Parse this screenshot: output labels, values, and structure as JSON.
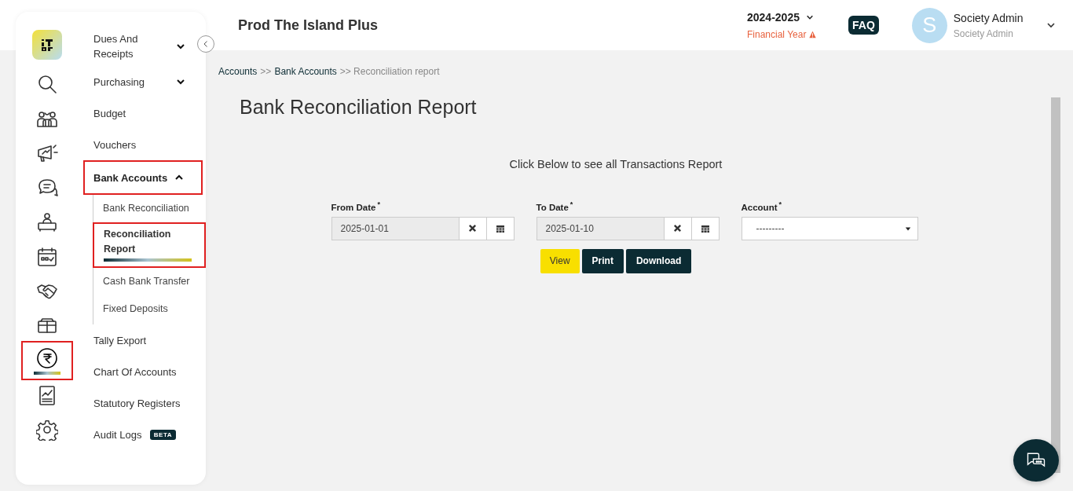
{
  "header": {
    "title": "Prod The Island Plus",
    "year": "2024-2025",
    "year_label": "Financial Year",
    "faq": "FAQ",
    "avatar_letter": "S",
    "user_name": "Society Admin",
    "user_role": "Society Admin"
  },
  "rail": [
    {
      "kind": "logo",
      "selected": false,
      "highlighted": false
    },
    {
      "kind": "search",
      "selected": false,
      "highlighted": false
    },
    {
      "kind": "people",
      "selected": false,
      "highlighted": false
    },
    {
      "kind": "megaphone",
      "selected": false,
      "highlighted": false
    },
    {
      "kind": "chat",
      "selected": false,
      "highlighted": false
    },
    {
      "kind": "desk",
      "selected": false,
      "highlighted": false
    },
    {
      "kind": "calendar",
      "selected": false,
      "highlighted": false
    },
    {
      "kind": "handshake",
      "selected": false,
      "highlighted": false
    },
    {
      "kind": "box",
      "selected": false,
      "highlighted": false
    },
    {
      "kind": "rupee",
      "selected": true,
      "highlighted": true
    },
    {
      "kind": "chart",
      "selected": false,
      "highlighted": false
    },
    {
      "kind": "gear",
      "selected": false,
      "highlighted": false
    }
  ],
  "menu": [
    {
      "label": "Dues And Receipts",
      "expanded": false,
      "highlighted": false
    },
    {
      "label": "Purchasing",
      "expanded": false,
      "highlighted": false
    },
    {
      "label": "Budget",
      "highlighted": false
    },
    {
      "label": "Vouchers",
      "highlighted": false
    },
    {
      "label": "Bank Accounts",
      "expanded": true,
      "highlighted": true,
      "children": [
        {
          "label": "Bank Reconciliation",
          "selected": false,
          "highlighted": false
        },
        {
          "label": "Reconciliation Report",
          "selected": true,
          "highlighted": true
        },
        {
          "label": "Cash Bank Transfer",
          "selected": false,
          "highlighted": false
        },
        {
          "label": "Fixed Deposits",
          "selected": false,
          "highlighted": false
        }
      ]
    },
    {
      "label": "Tally Export",
      "highlighted": false
    },
    {
      "label": "Chart Of Accounts",
      "highlighted": false
    },
    {
      "label": "Statutory Registers",
      "highlighted": false
    },
    {
      "label": "Audit Logs",
      "badge": "BETA",
      "highlighted": false
    }
  ],
  "breadcrumb": [
    {
      "label": "Accounts",
      "link": true
    },
    {
      "label": ">>",
      "link": false
    },
    {
      "label": "Bank Accounts",
      "link": true
    },
    {
      "label": ">> Reconciliation report",
      "link": false
    }
  ],
  "page_title": "Bank Reconciliation Report",
  "intro": "Click Below to see all Transactions Report",
  "fields": [
    {
      "kind": "date",
      "label": "From Date",
      "required_mark": "*",
      "value": "2025-01-01"
    },
    {
      "kind": "date",
      "label": "To Date",
      "required_mark": "*",
      "value": "2025-01-10"
    },
    {
      "kind": "select",
      "label": "Account",
      "required_mark": "*",
      "value": "---------"
    }
  ],
  "buttons": [
    {
      "label": "View",
      "kind": "primary"
    },
    {
      "label": "Print",
      "kind": "dark"
    },
    {
      "label": "Download",
      "kind": "dark"
    }
  ]
}
